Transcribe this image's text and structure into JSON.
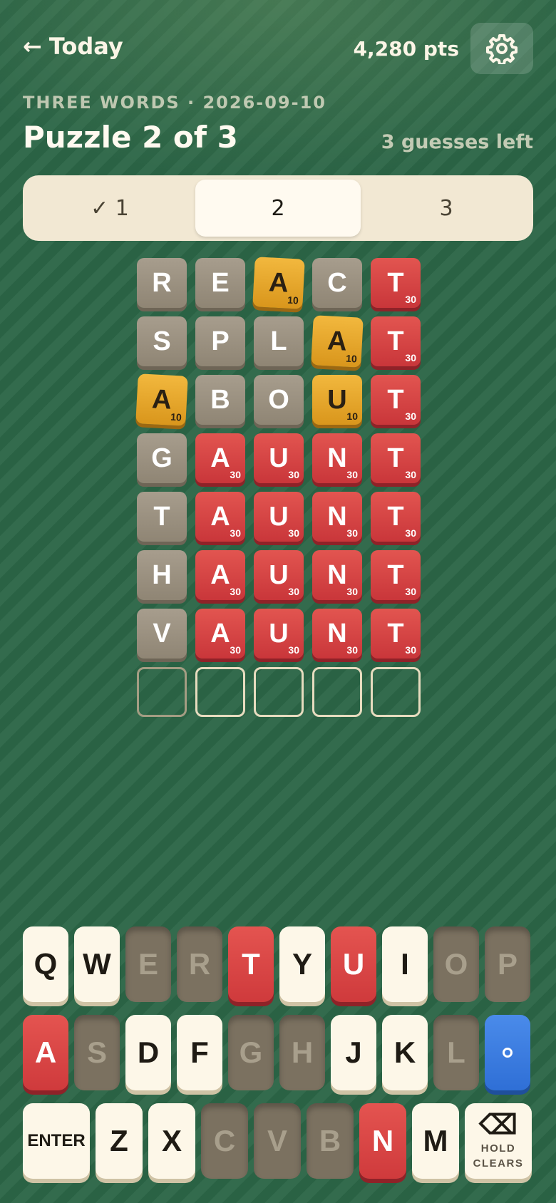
{
  "header": {
    "back_arrow": "←",
    "back_label": "Today",
    "points": "4,280 pts",
    "settings_icon": "gear-icon"
  },
  "puzzle": {
    "subtitle": "THREE WORDS · 2026-09-10",
    "title": "Puzzle 2 of 3",
    "guesses_left": "3 guesses left"
  },
  "tabs": [
    {
      "label": "✓ 1",
      "state": "solved"
    },
    {
      "label": "2",
      "state": "active"
    },
    {
      "label": "3",
      "state": "pending"
    }
  ],
  "board": {
    "rows": [
      [
        {
          "l": "R",
          "s": "gray"
        },
        {
          "l": "E",
          "s": "gray"
        },
        {
          "l": "A",
          "s": "gold",
          "p": "10"
        },
        {
          "l": "C",
          "s": "gray"
        },
        {
          "l": "T",
          "s": "red",
          "p": "30"
        }
      ],
      [
        {
          "l": "S",
          "s": "gray"
        },
        {
          "l": "P",
          "s": "gray"
        },
        {
          "l": "L",
          "s": "gray"
        },
        {
          "l": "A",
          "s": "gold",
          "p": "10"
        },
        {
          "l": "T",
          "s": "red",
          "p": "30"
        }
      ],
      [
        {
          "l": "A",
          "s": "gold",
          "p": "10"
        },
        {
          "l": "B",
          "s": "gray"
        },
        {
          "l": "O",
          "s": "gray"
        },
        {
          "l": "U",
          "s": "gold",
          "p": "10"
        },
        {
          "l": "T",
          "s": "red",
          "p": "30"
        }
      ],
      [
        {
          "l": "G",
          "s": "gray"
        },
        {
          "l": "A",
          "s": "red",
          "p": "30"
        },
        {
          "l": "U",
          "s": "red",
          "p": "30"
        },
        {
          "l": "N",
          "s": "red",
          "p": "30"
        },
        {
          "l": "T",
          "s": "red",
          "p": "30"
        }
      ],
      [
        {
          "l": "T",
          "s": "gray"
        },
        {
          "l": "A",
          "s": "red",
          "p": "30"
        },
        {
          "l": "U",
          "s": "red",
          "p": "30"
        },
        {
          "l": "N",
          "s": "red",
          "p": "30"
        },
        {
          "l": "T",
          "s": "red",
          "p": "30"
        }
      ],
      [
        {
          "l": "H",
          "s": "gray"
        },
        {
          "l": "A",
          "s": "red",
          "p": "30"
        },
        {
          "l": "U",
          "s": "red",
          "p": "30"
        },
        {
          "l": "N",
          "s": "red",
          "p": "30"
        },
        {
          "l": "T",
          "s": "red",
          "p": "30"
        }
      ],
      [
        {
          "l": "V",
          "s": "gray"
        },
        {
          "l": "A",
          "s": "red",
          "p": "30"
        },
        {
          "l": "U",
          "s": "red",
          "p": "30"
        },
        {
          "l": "N",
          "s": "red",
          "p": "30"
        },
        {
          "l": "T",
          "s": "red",
          "p": "30"
        }
      ],
      [
        {
          "l": "",
          "s": "empty-dim"
        },
        {
          "l": "",
          "s": "empty"
        },
        {
          "l": "",
          "s": "empty"
        },
        {
          "l": "",
          "s": "empty"
        },
        {
          "l": "",
          "s": "empty"
        }
      ]
    ]
  },
  "keyboard": {
    "rows": [
      [
        {
          "k": "Q",
          "s": "unused"
        },
        {
          "k": "W",
          "s": "unused"
        },
        {
          "k": "E",
          "s": "absent"
        },
        {
          "k": "R",
          "s": "absent"
        },
        {
          "k": "T",
          "s": "hit"
        },
        {
          "k": "Y",
          "s": "unused"
        },
        {
          "k": "U",
          "s": "hit"
        },
        {
          "k": "I",
          "s": "unused"
        },
        {
          "k": "O",
          "s": "absent"
        },
        {
          "k": "P",
          "s": "absent"
        }
      ],
      [
        {
          "k": "A",
          "s": "hit"
        },
        {
          "k": "S",
          "s": "absent"
        },
        {
          "k": "D",
          "s": "unused"
        },
        {
          "k": "F",
          "s": "unused"
        },
        {
          "k": "G",
          "s": "absent"
        },
        {
          "k": "H",
          "s": "absent"
        },
        {
          "k": "J",
          "s": "unused"
        },
        {
          "k": "K",
          "s": "unused"
        },
        {
          "k": "L",
          "s": "absent"
        },
        {
          "k": "",
          "s": "blue",
          "icon": "dot-icon"
        }
      ],
      [
        {
          "k": "ENTER",
          "s": "unused",
          "type": "enter"
        },
        {
          "k": "Z",
          "s": "unused"
        },
        {
          "k": "X",
          "s": "unused"
        },
        {
          "k": "C",
          "s": "absent"
        },
        {
          "k": "V",
          "s": "absent"
        },
        {
          "k": "B",
          "s": "absent"
        },
        {
          "k": "N",
          "s": "hit"
        },
        {
          "k": "M",
          "s": "unused"
        },
        {
          "k": "⌫",
          "s": "unused",
          "type": "backspace",
          "line1": "HOLD",
          "line2": "CLEARS"
        }
      ]
    ]
  },
  "colors": {
    "background": "#2c6647",
    "hit": "#d7403f",
    "present": "#e6a62a",
    "absent": "#9a907e",
    "accent_blue": "#3a7be0"
  }
}
